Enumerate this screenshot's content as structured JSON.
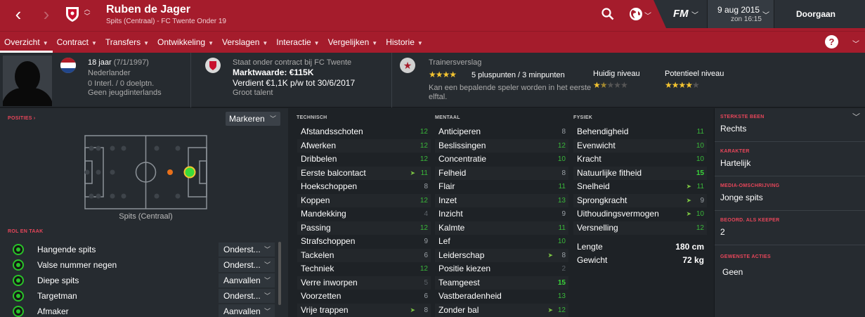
{
  "header": {
    "name": "Ruben de Jager",
    "subtitle": "Spits (Centraal) - FC Twente Onder 19",
    "date": "9 aug 2015",
    "time": "zon 16:15",
    "continue": "Doorgaan",
    "fm_logo": "FM"
  },
  "menu": [
    {
      "label": "Overzicht"
    },
    {
      "label": "Contract"
    },
    {
      "label": "Transfers"
    },
    {
      "label": "Ontwikkeling"
    },
    {
      "label": "Verslagen"
    },
    {
      "label": "Interactie"
    },
    {
      "label": "Vergelijken"
    },
    {
      "label": "Historie"
    }
  ],
  "bio": {
    "age": "18 jaar",
    "dob": "(7/1/1997)",
    "nationality": "Nederlander",
    "caps": "0 Interl. / 0 doelptn.",
    "youth": "Geen jeugdinterlands"
  },
  "contract": {
    "line": "Staat onder contract bij FC Twente",
    "value": "Marktwaarde: €115K",
    "wage": "Verdient €1,1K p/w tot 30/6/2017",
    "talent": "Groot talent"
  },
  "scout": {
    "title": "Trainersverslag",
    "points": "5 pluspunten / 3 minpunten",
    "note1": "Kan een bepalende speler worden in het eerste",
    "note2": "elftal.",
    "current_label": "Huidig niveau",
    "potential_label": "Potentieel niveau",
    "current_stars": 1.5,
    "potential_stars": 4,
    "summary_stars": 4
  },
  "positions": {
    "header": "POSITIES",
    "mark_btn": "Markeren",
    "position_label": "Spits (Centraal)"
  },
  "roles": {
    "header": "ROL EN TAAK",
    "items": [
      {
        "name": "Hangende spits",
        "duty": "Onderst..."
      },
      {
        "name": "Valse nummer negen",
        "duty": "Onderst..."
      },
      {
        "name": "Diepe spits",
        "duty": "Aanvallen"
      },
      {
        "name": "Targetman",
        "duty": "Onderst..."
      },
      {
        "name": "Afmaker",
        "duty": "Aanvallen"
      }
    ]
  },
  "technical": {
    "header": "TECHNISCH",
    "attrs": [
      {
        "name": "Afstandsschoten",
        "value": "12"
      },
      {
        "name": "Afwerken",
        "value": "12"
      },
      {
        "name": "Dribbelen",
        "value": "12"
      },
      {
        "name": "Eerste balcontact",
        "value": "11"
      },
      {
        "name": "Hoekschoppen",
        "value": "8"
      },
      {
        "name": "Koppen",
        "value": "12"
      },
      {
        "name": "Mandekking",
        "value": "4"
      },
      {
        "name": "Passing",
        "value": "12"
      },
      {
        "name": "Strafschoppen",
        "value": "9"
      },
      {
        "name": "Tackelen",
        "value": "6"
      },
      {
        "name": "Techniek",
        "value": "12"
      },
      {
        "name": "Verre inworpen",
        "value": "5"
      },
      {
        "name": "Voorzetten",
        "value": "6"
      },
      {
        "name": "Vrije trappen",
        "value": "8"
      }
    ]
  },
  "mental": {
    "header": "MENTAAL",
    "attrs": [
      {
        "name": "Anticiperen",
        "value": "8"
      },
      {
        "name": "Beslissingen",
        "value": "12"
      },
      {
        "name": "Concentratie",
        "value": "10"
      },
      {
        "name": "Felheid",
        "value": "8"
      },
      {
        "name": "Flair",
        "value": "11"
      },
      {
        "name": "Inzet",
        "value": "13"
      },
      {
        "name": "Inzicht",
        "value": "9"
      },
      {
        "name": "Kalmte",
        "value": "11"
      },
      {
        "name": "Lef",
        "value": "10"
      },
      {
        "name": "Leiderschap",
        "value": "8"
      },
      {
        "name": "Positie kiezen",
        "value": "2"
      },
      {
        "name": "Teamgeest",
        "value": "15"
      },
      {
        "name": "Vastberadenheid",
        "value": "13"
      },
      {
        "name": "Zonder bal",
        "value": "12"
      }
    ]
  },
  "physical": {
    "header": "FYSIEK",
    "attrs": [
      {
        "name": "Behendigheid",
        "value": "11"
      },
      {
        "name": "Evenwicht",
        "value": "10"
      },
      {
        "name": "Kracht",
        "value": "10"
      },
      {
        "name": "Natuurlijke fitheid",
        "value": "15"
      },
      {
        "name": "Snelheid",
        "value": "11"
      },
      {
        "name": "Sprongkracht",
        "value": "9"
      },
      {
        "name": "Uithoudingsvermogen",
        "value": "10"
      },
      {
        "name": "Versnelling",
        "value": "12"
      }
    ],
    "height_label": "Lengte",
    "height": "180 cm",
    "weight_label": "Gewicht",
    "weight": "72 kg"
  },
  "side": {
    "foot_h": "STERKSTE BEEN",
    "foot": "Rechts",
    "char_h": "KARAKTER",
    "char": "Hartelijk",
    "media_h": "MEDIA-OMSCHRIJVING",
    "media": "Jonge spits",
    "gk_h": "BEOORD. ALS KEEPER",
    "gk": "2",
    "pref_h": "GEWENSTE ACTIES",
    "pref": "Geen"
  },
  "colors": {
    "brand": "#a51c2c",
    "good": "#3ab83a",
    "star": "#f4c430"
  }
}
